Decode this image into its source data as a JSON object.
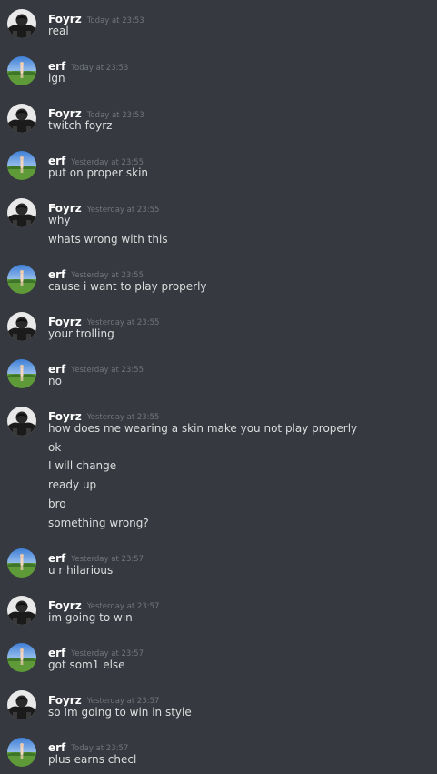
{
  "messages": [
    {
      "author": "Foyrz",
      "avatar": "foyrz",
      "timestamp": "Today at 23:53",
      "lines": [
        "real"
      ]
    },
    {
      "author": "erf",
      "avatar": "erf",
      "timestamp": "Today at 23:53",
      "lines": [
        "ign"
      ]
    },
    {
      "author": "Foyrz",
      "avatar": "foyrz",
      "timestamp": "Today at 23:53",
      "lines": [
        "twitch foyrz"
      ]
    },
    {
      "author": "erf",
      "avatar": "erf",
      "timestamp": "Yesterday at 23:55",
      "lines": [
        "put on proper skin"
      ]
    },
    {
      "author": "Foyrz",
      "avatar": "foyrz",
      "timestamp": "Yesterday at 23:55",
      "lines": [
        "why",
        "whats wrong with this"
      ]
    },
    {
      "author": "erf",
      "avatar": "erf",
      "timestamp": "Yesterday at 23:55",
      "lines": [
        "cause i want to play properly"
      ]
    },
    {
      "author": "Foyrz",
      "avatar": "foyrz",
      "timestamp": "Yesterday at 23:55",
      "lines": [
        "your trolling"
      ]
    },
    {
      "author": "erf",
      "avatar": "erf",
      "timestamp": "Yesterday at 23:55",
      "lines": [
        "no"
      ]
    },
    {
      "author": "Foyrz",
      "avatar": "foyrz",
      "timestamp": "Yesterday at 23:55",
      "lines": [
        "how does me wearing a skin make you not play properly",
        "ok",
        "I will change",
        "ready up",
        "bro",
        "something wrong?"
      ]
    },
    {
      "author": "erf",
      "avatar": "erf",
      "timestamp": "Yesterday at 23:57",
      "lines": [
        "u r hilarious"
      ]
    },
    {
      "author": "Foyrz",
      "avatar": "foyrz",
      "timestamp": "Yesterday at 23:57",
      "lines": [
        "im going to win"
      ]
    },
    {
      "author": "erf",
      "avatar": "erf",
      "timestamp": "Yesterday at 23:57",
      "lines": [
        "got som1 else"
      ]
    },
    {
      "author": "Foyrz",
      "avatar": "foyrz",
      "timestamp": "Yesterday at 23:57",
      "lines": [
        "so Im going to win in style"
      ]
    },
    {
      "author": "erf",
      "avatar": "erf",
      "timestamp": "Today at 23:57",
      "lines": [
        "plus earns checl"
      ]
    }
  ],
  "colors": {
    "background": "#36393f",
    "username": "#ffffff",
    "timestamp": "#72767d",
    "message_text": "#dcddde"
  }
}
